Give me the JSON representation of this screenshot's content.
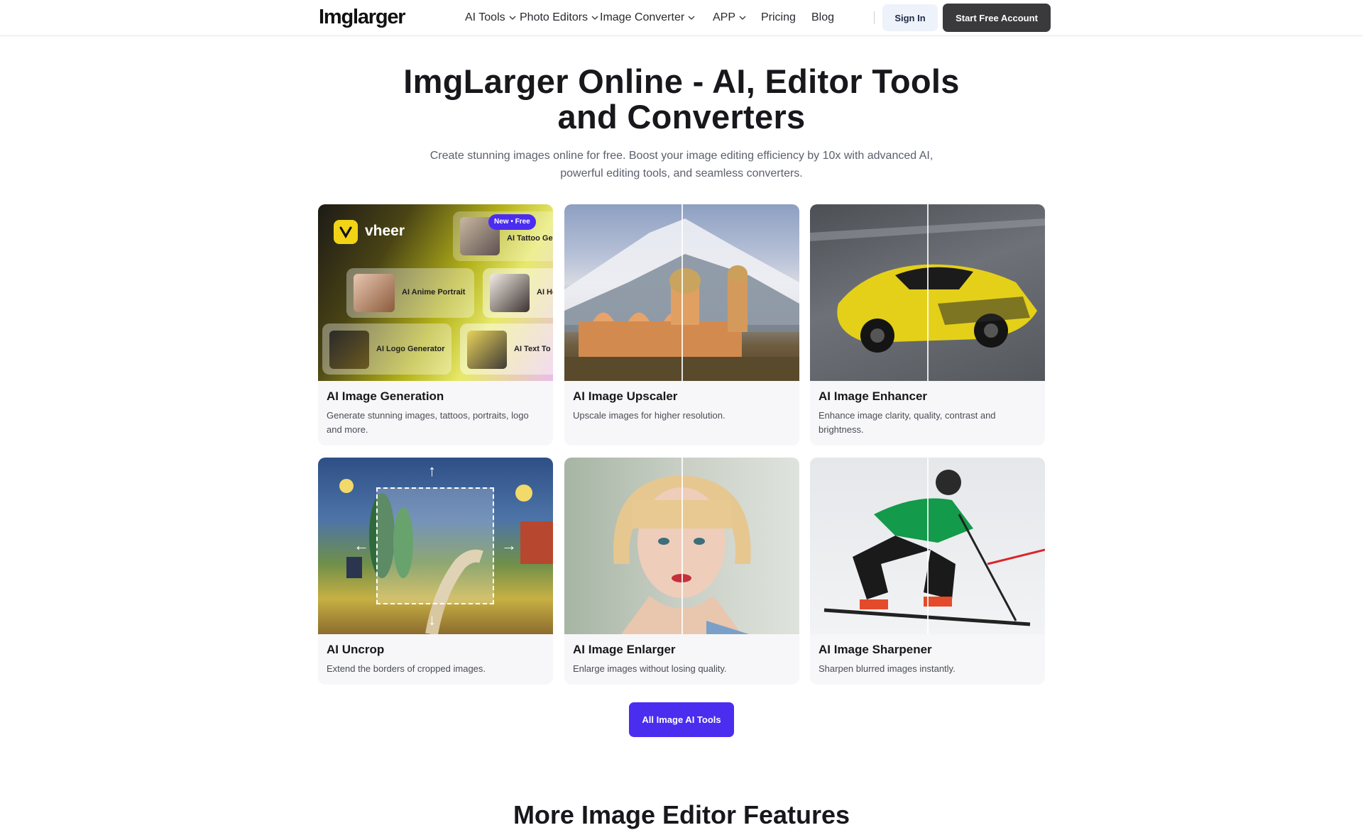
{
  "header": {
    "logo": "Imglarger",
    "nav": [
      {
        "label": "AI Tools",
        "dropdown": true
      },
      {
        "label": "Photo Editors",
        "dropdown": true
      },
      {
        "label": "Image Converter",
        "dropdown": true
      },
      {
        "label": "APP",
        "dropdown": true
      },
      {
        "label": "Pricing",
        "dropdown": false
      },
      {
        "label": "Blog",
        "dropdown": false
      }
    ],
    "signin": "Sign In",
    "start": "Start Free Account"
  },
  "hero": {
    "title_line1": "ImgLarger Online - AI, Editor Tools",
    "title_line2": "and Converters",
    "subtitle_line1": "Create stunning images online for free. Boost your image editing efficiency by 10x with advanced AI,",
    "subtitle_line2": "powerful editing tools, and seamless converters."
  },
  "promo": {
    "brand": "vheer",
    "badge": "New • Free",
    "tiles": [
      "AI Tattoo Ge",
      "AI Anime Portrait",
      "AI He",
      "AI Logo Generator",
      "AI Text To I"
    ]
  },
  "cards": [
    {
      "title": "AI Image Generation",
      "desc": "Generate stunning images, tattoos, portraits, logo and more."
    },
    {
      "title": "AI Image Upscaler",
      "desc": "Upscale images for higher resolution."
    },
    {
      "title": "AI Image Enhancer",
      "desc": "Enhance image clarity, quality, contrast and brightness."
    },
    {
      "title": "AI Uncrop",
      "desc": "Extend the borders of cropped images."
    },
    {
      "title": "AI Image Enlarger",
      "desc": "Enlarge images without losing quality."
    },
    {
      "title": "AI Image Sharpener",
      "desc": "Sharpen blurred images instantly."
    }
  ],
  "cta": "All Image AI Tools",
  "more_title": "More Image Editor Features",
  "colors": {
    "accent": "#4b2df0",
    "dark_button": "#3a3a3d",
    "signin_bg": "#eef2fb"
  }
}
